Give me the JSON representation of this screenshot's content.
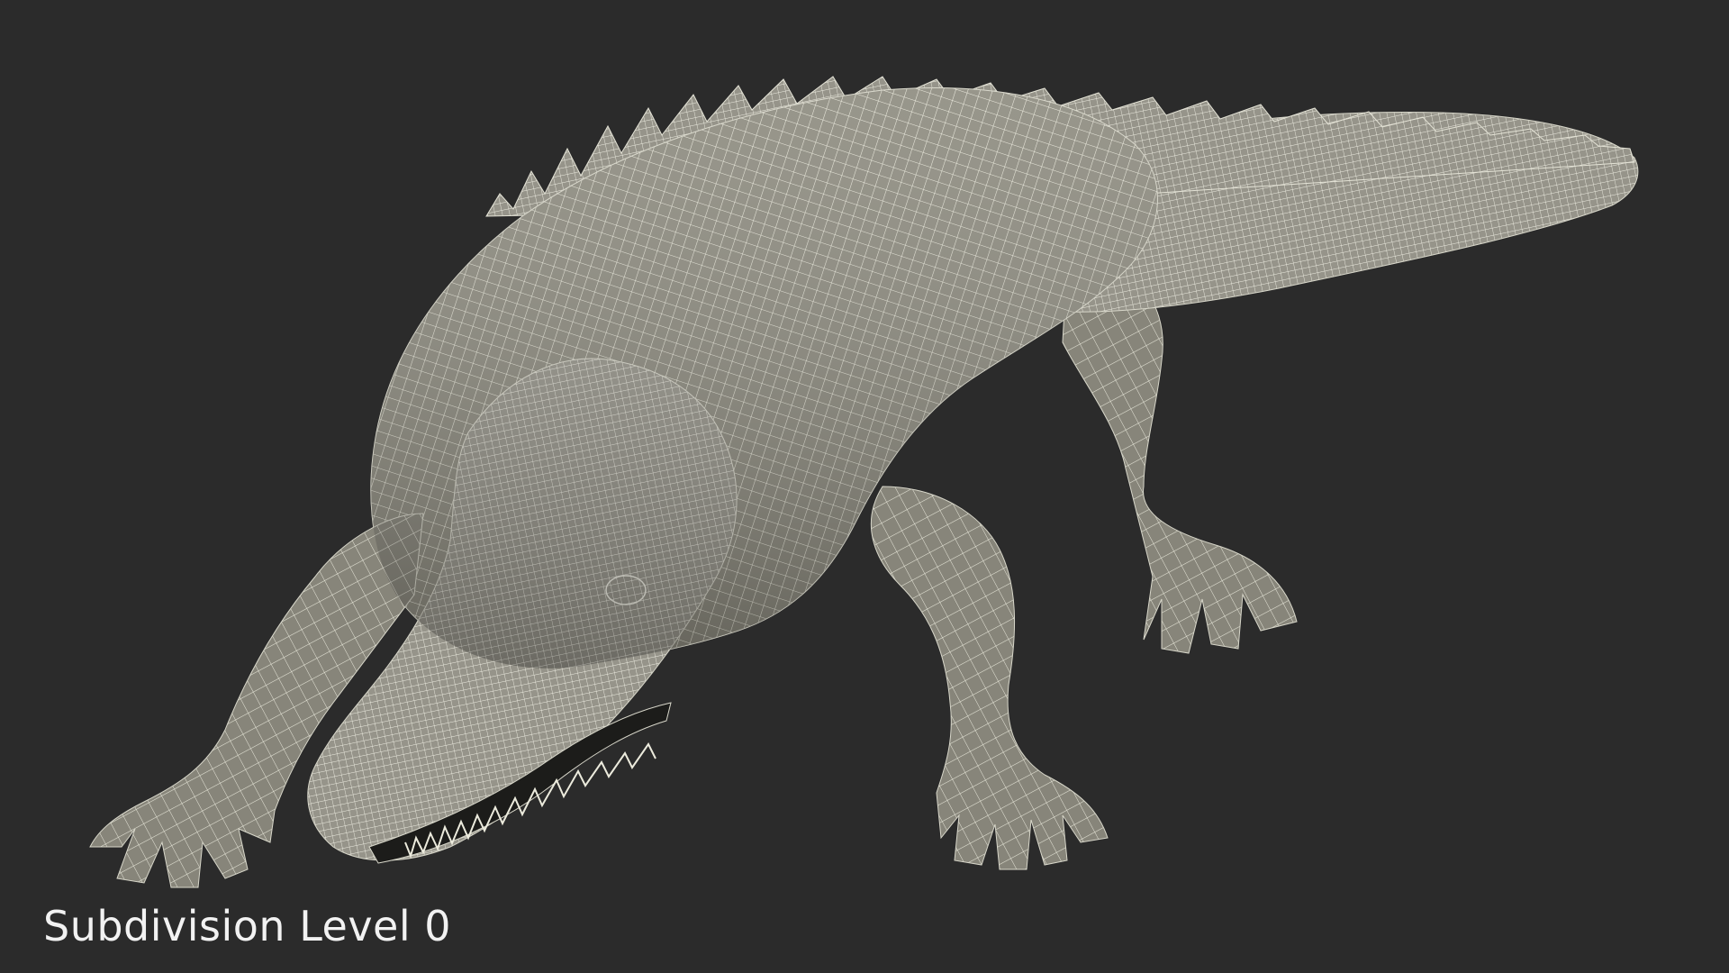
{
  "caption": "Subdivision Level 0",
  "colors": {
    "background": "#2b2b2b",
    "model_fill": "#8f8d80",
    "wire": "#ecebdd",
    "caption": "#f2f2f2"
  },
  "subject": {
    "icon": "crocodile-wireframe-model"
  }
}
